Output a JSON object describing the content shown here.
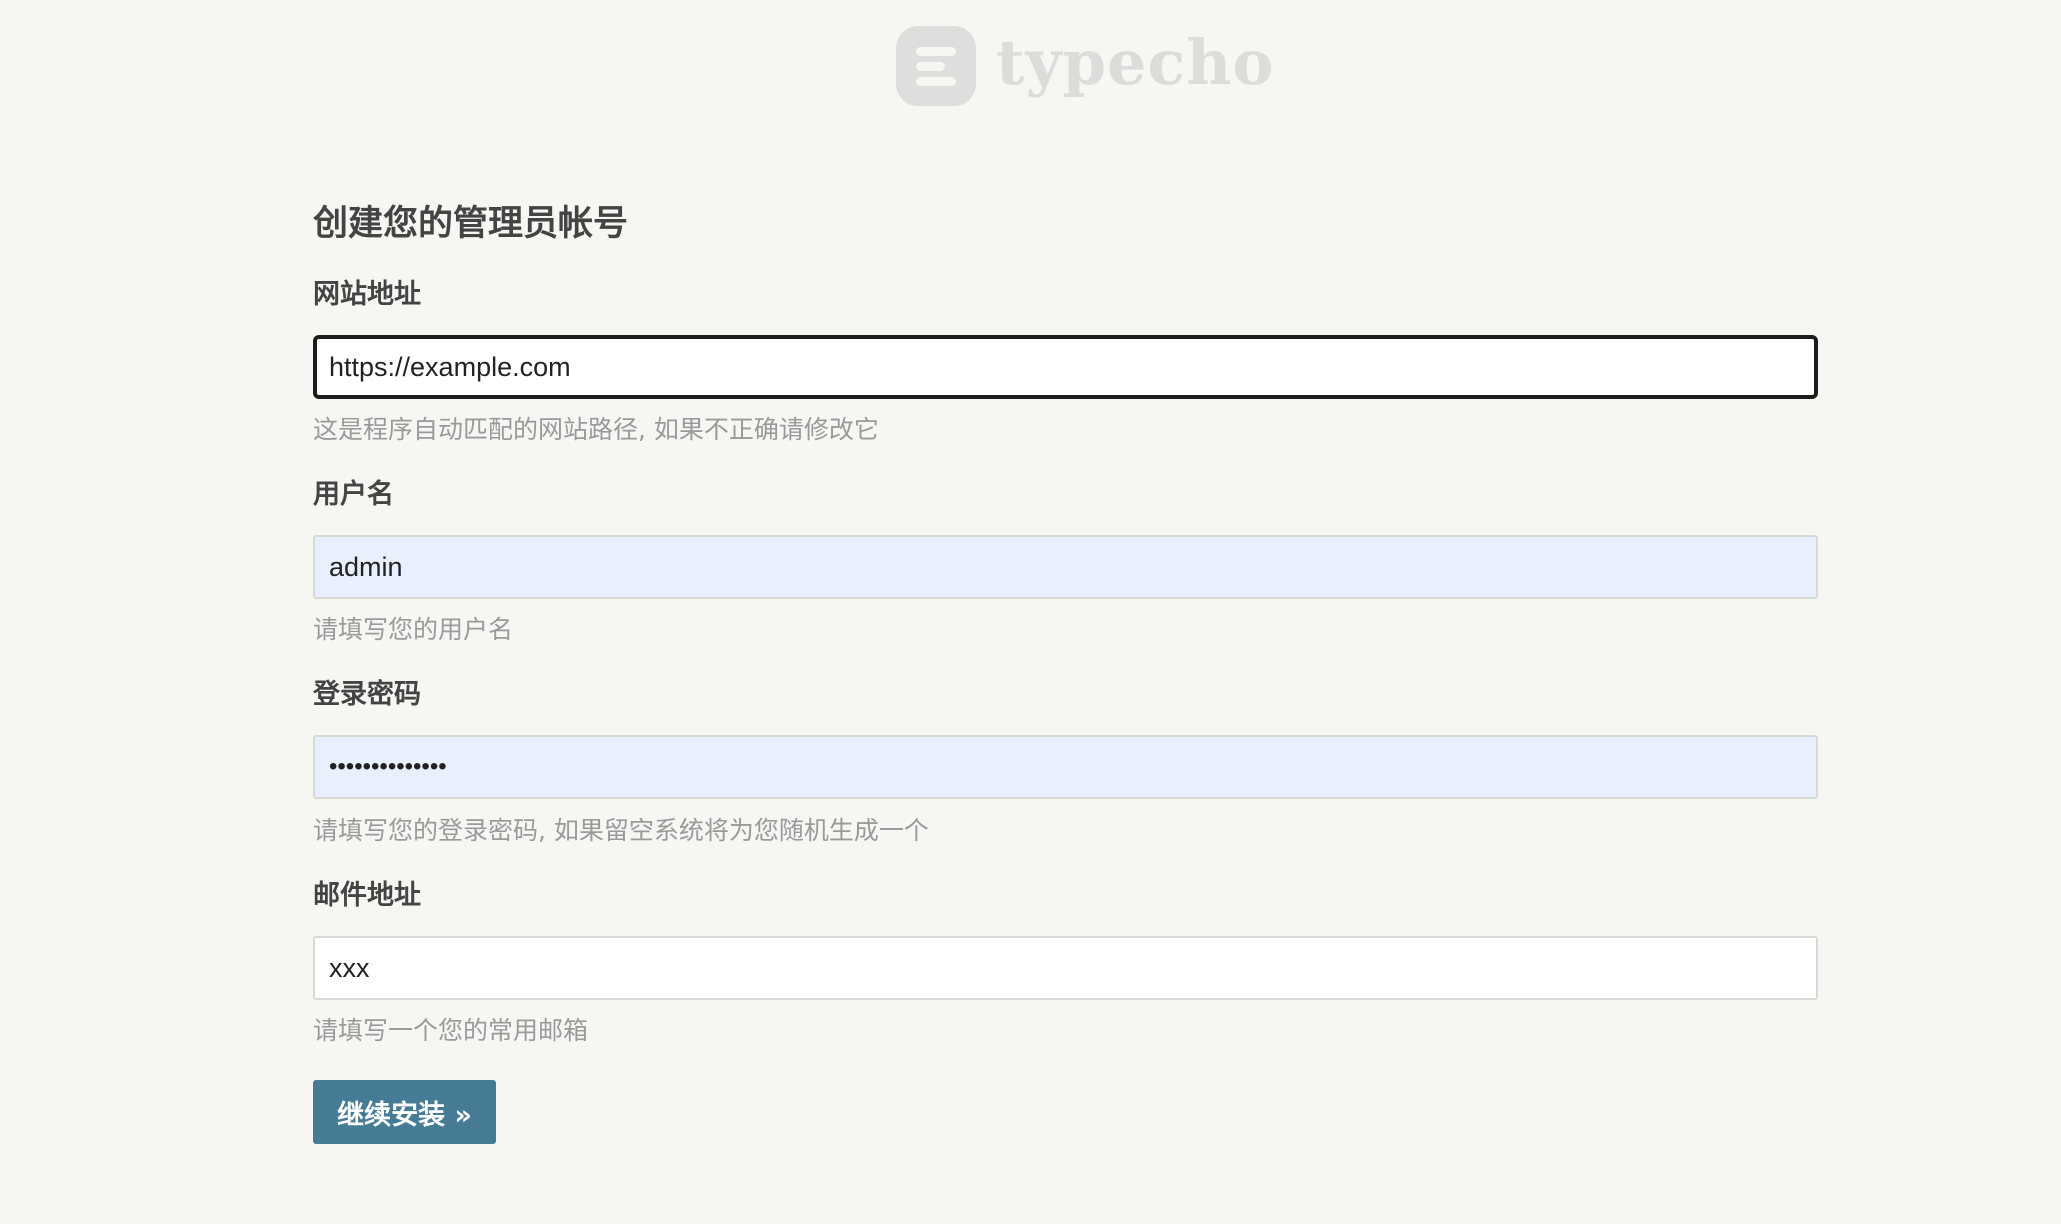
{
  "logo": {
    "icon": "typecho-logo-icon",
    "text": "typecho",
    "color": "#dcdcda"
  },
  "title": "创建您的管理员帐号",
  "fields": [
    {
      "label": "网站地址",
      "value": "https://example.com",
      "hint": "这是程序自动匹配的网站路径, 如果不正确请修改它",
      "state": "focused"
    },
    {
      "label": "用户名",
      "value": "admin",
      "hint": "请填写您的用户名",
      "state": "autofilled"
    },
    {
      "label": "登录密码",
      "value": "••••••••••••••",
      "hint": "请填写您的登录密码, 如果留空系统将为您随机生成一个",
      "state": "autofilled"
    },
    {
      "label": "邮件地址",
      "value": "xxx",
      "hint": "请填写一个您的常用邮箱",
      "state": "default"
    }
  ],
  "submit_label": "继续安装 »",
  "colors": {
    "background": "#f6f6f3",
    "primary_button": "#467b96",
    "autofill_bg": "#e8f0fe",
    "hint_text": "#9a9a9a"
  }
}
